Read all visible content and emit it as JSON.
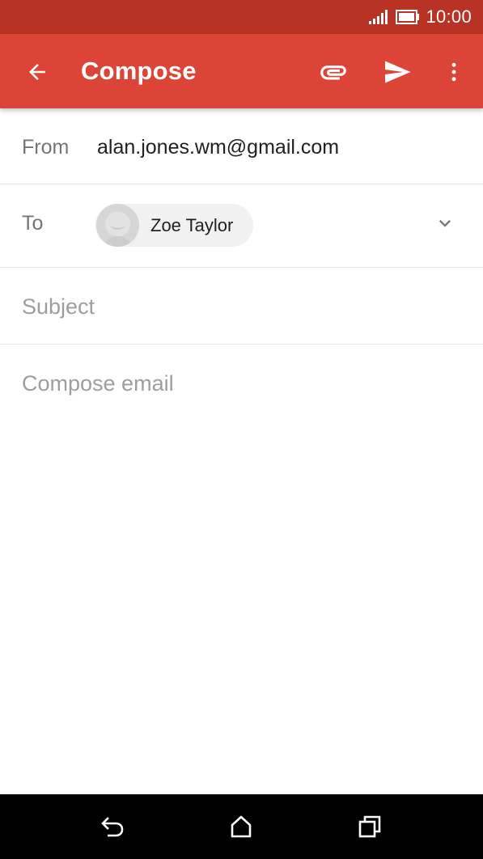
{
  "status_bar": {
    "time": "10:00",
    "signal_icon": "signal-icon",
    "battery_icon": "battery-icon"
  },
  "app_bar": {
    "title": "Compose",
    "background_color": "#db4437",
    "icons": [
      "back-arrow-icon",
      "attachment-icon",
      "send-icon",
      "more-vert-icon"
    ]
  },
  "compose": {
    "from_label": "From",
    "from_value": "alan.jones.wm@gmail.com",
    "to_label": "To",
    "recipients": [
      {
        "name": "Zoe Taylor",
        "avatar_icon": "default-avatar-icon"
      }
    ],
    "subject_placeholder": "Subject",
    "body_placeholder": "Compose email"
  },
  "nav_bar": {
    "icons": [
      "back-icon",
      "home-icon",
      "recents-icon"
    ]
  }
}
